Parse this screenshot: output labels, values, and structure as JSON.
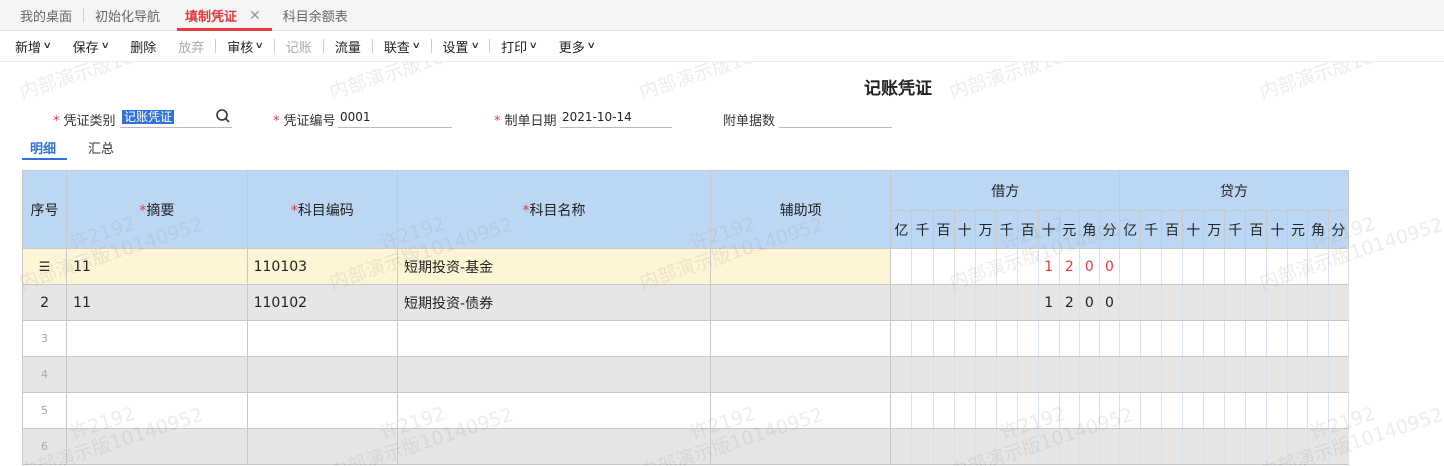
{
  "tabs": [
    {
      "label": "我的桌面",
      "active": false
    },
    {
      "label": "初始化导航",
      "active": false
    },
    {
      "label": "填制凭证",
      "active": true
    },
    {
      "label": "科目余额表",
      "active": false
    }
  ],
  "toolbar": [
    {
      "label": "新增",
      "dropdown": true,
      "disabled": false
    },
    {
      "label": "保存",
      "dropdown": true,
      "disabled": false
    },
    {
      "label": "删除",
      "dropdown": false,
      "disabled": false
    },
    {
      "label": "放弃",
      "dropdown": false,
      "disabled": true
    },
    {
      "label": "审核",
      "dropdown": true,
      "disabled": false
    },
    {
      "label": "记账",
      "dropdown": false,
      "disabled": true
    },
    {
      "label": "流量",
      "dropdown": false,
      "disabled": false
    },
    {
      "label": "联查",
      "dropdown": true,
      "disabled": false
    },
    {
      "label": "设置",
      "dropdown": true,
      "disabled": false
    },
    {
      "label": "打印",
      "dropdown": true,
      "disabled": false
    },
    {
      "label": "更多",
      "dropdown": true,
      "disabled": false
    }
  ],
  "watermark": {
    "line1": "许2192",
    "line2": "内部演示版10140952"
  },
  "voucher": {
    "title": "记账凭证",
    "type_label": "凭证类别",
    "type_value": "记账凭证",
    "number_label": "凭证编号",
    "number_value": "0001",
    "date_label": "制单日期",
    "date_value": "2021-10-14",
    "attach_label": "附单据数",
    "attach_value": ""
  },
  "subtabs": [
    {
      "label": "明细",
      "active": true
    },
    {
      "label": "汇总",
      "active": false
    }
  ],
  "grid": {
    "headers": {
      "seq": "序号",
      "summary": "摘要",
      "code": "科目编码",
      "name": "科目名称",
      "aux": "辅助项",
      "debit": "借方",
      "credit": "贷方"
    },
    "digits": [
      "亿",
      "千",
      "百",
      "十",
      "万",
      "千",
      "百",
      "十",
      "元",
      "角",
      "分"
    ],
    "rows": [
      {
        "seq": "",
        "summary": "11",
        "code": "110103",
        "name": "短期投资-基金",
        "aux": "",
        "debit": [
          "",
          "",
          "",
          "",
          "",
          "",
          "",
          "1",
          "2",
          "0",
          "0"
        ],
        "credit": [
          "",
          "",
          "",
          "",
          "",
          "",
          "",
          "",
          "",
          "",
          ""
        ]
      },
      {
        "seq": "2",
        "summary": "11",
        "code": "110102",
        "name": "短期投资-债券",
        "aux": "",
        "debit": [
          "",
          "",
          "",
          "",
          "",
          "",
          "",
          "1",
          "2",
          "0",
          "0"
        ],
        "credit": [
          "",
          "",
          "",
          "",
          "",
          "",
          "",
          "",
          "",
          "",
          ""
        ]
      },
      {
        "seq": "3",
        "summary": "",
        "code": "",
        "name": "",
        "aux": "",
        "debit": [
          "",
          "",
          "",
          "",
          "",
          "",
          "",
          "",
          "",
          "",
          ""
        ],
        "credit": [
          "",
          "",
          "",
          "",
          "",
          "",
          "",
          "",
          "",
          "",
          ""
        ]
      },
      {
        "seq": "4",
        "summary": "",
        "code": "",
        "name": "",
        "aux": "",
        "debit": [
          "",
          "",
          "",
          "",
          "",
          "",
          "",
          "",
          "",
          "",
          ""
        ],
        "credit": [
          "",
          "",
          "",
          "",
          "",
          "",
          "",
          "",
          "",
          "",
          ""
        ]
      },
      {
        "seq": "5",
        "summary": "",
        "code": "",
        "name": "",
        "aux": "",
        "debit": [
          "",
          "",
          "",
          "",
          "",
          "",
          "",
          "",
          "",
          "",
          ""
        ],
        "credit": [
          "",
          "",
          "",
          "",
          "",
          "",
          "",
          "",
          "",
          "",
          ""
        ]
      },
      {
        "seq": "6",
        "summary": "",
        "code": "",
        "name": "",
        "aux": "",
        "debit": [
          "",
          "",
          "",
          "",
          "",
          "",
          "",
          "",
          "",
          "",
          ""
        ],
        "credit": [
          "",
          "",
          "",
          "",
          "",
          "",
          "",
          "",
          "",
          "",
          ""
        ]
      }
    ]
  },
  "colors": {
    "accent": "#e23b3b",
    "header_bg": "#bcd7f3",
    "selected_row": "#fdf5d3",
    "alt_row": "#e6e6e6",
    "link_blue": "#2f73d8"
  }
}
